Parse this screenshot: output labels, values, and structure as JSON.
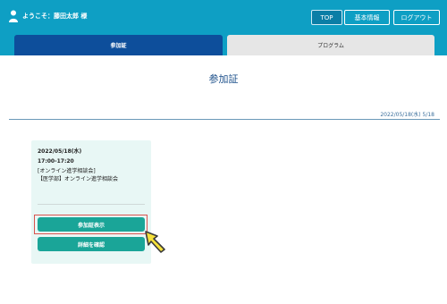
{
  "header": {
    "welcome": "ようこそ：藤田太郎 様",
    "buttons": {
      "top": "TOP",
      "basic": "基本情報",
      "logout": "ログアウト"
    }
  },
  "tabs": [
    {
      "label": "参加証",
      "active": true
    },
    {
      "label": "プログラム",
      "active": false
    }
  ],
  "page": {
    "title": "参加証",
    "datestamp": "2022/05/18(水) 5/18"
  },
  "card": {
    "date": "2022/05/18(水)",
    "time": "17:00-17:20",
    "category": "[オンライン進学相談会]",
    "title": "【医学部】オンライン進学相談会",
    "view_button": "参加証表示",
    "detail_button": "詳細を確認"
  },
  "colors": {
    "header_bg": "#0e9fc4",
    "tab_active": "#0d4e9b",
    "card_bg": "#e8f7f5",
    "button_teal": "#1aa598",
    "highlight": "#d9534f",
    "pointer_fill": "#f5e13a"
  },
  "icons": {
    "user": "user-icon",
    "pointer": "pointing-hand-icon"
  }
}
